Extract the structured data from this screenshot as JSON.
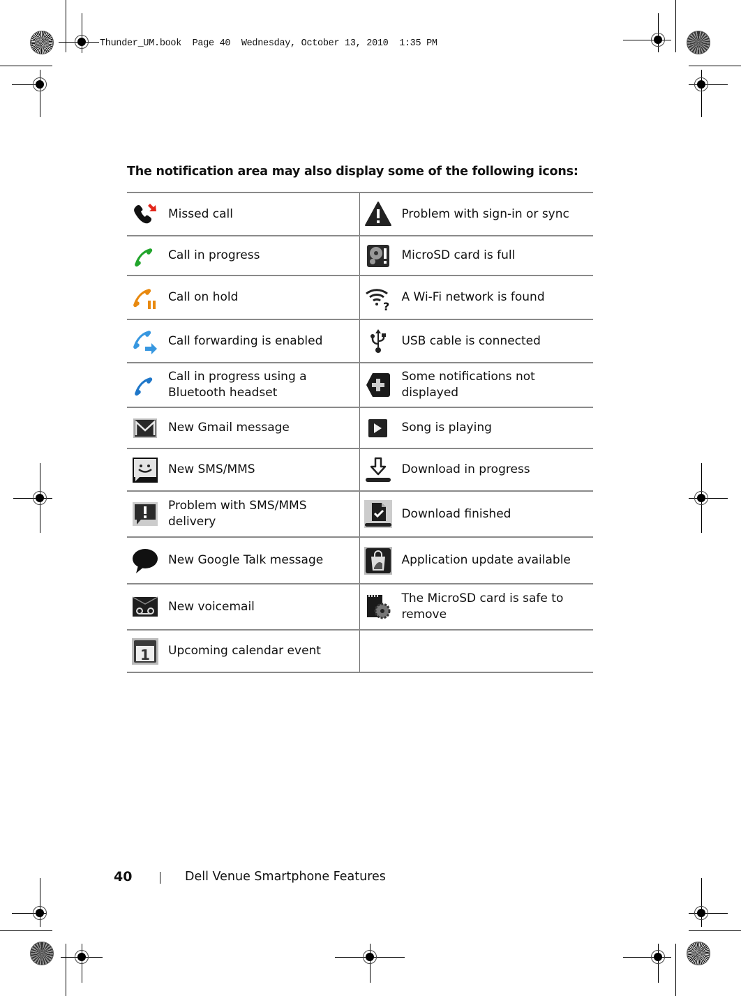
{
  "print_slug": "Thunder_UM.book  Page 40  Wednesday, October 13, 2010  1:35 PM",
  "heading": "The notification area may also display some of the following icons:",
  "table": {
    "rows": [
      {
        "left": {
          "icon": "missed-call-icon",
          "label": "Missed call"
        },
        "right": {
          "icon": "warning-icon",
          "label": "Problem with sign-in or sync"
        }
      },
      {
        "left": {
          "icon": "call-in-progress-icon",
          "label": "Call in progress"
        },
        "right": {
          "icon": "microsd-full-icon",
          "label": "MicroSD card is full"
        }
      },
      {
        "left": {
          "icon": "call-on-hold-icon",
          "label": "Call on hold"
        },
        "right": {
          "icon": "wifi-found-icon",
          "label": "A Wi-Fi network is found"
        }
      },
      {
        "left": {
          "icon": "call-forwarding-icon",
          "label": "Call forwarding is enabled"
        },
        "right": {
          "icon": "usb-icon",
          "label": "USB cable is connected"
        }
      },
      {
        "left": {
          "icon": "bluetooth-call-icon",
          "label": "Call in progress using a Bluetooth headset"
        },
        "right": {
          "icon": "more-notifications-icon",
          "label": "Some notifications not displayed"
        }
      },
      {
        "left": {
          "icon": "gmail-icon",
          "label": "New Gmail message"
        },
        "right": {
          "icon": "play-icon",
          "label": "Song is playing"
        }
      },
      {
        "left": {
          "icon": "sms-icon",
          "label": "New SMS/MMS"
        },
        "right": {
          "icon": "download-icon",
          "label": "Download in progress"
        }
      },
      {
        "left": {
          "icon": "sms-error-icon",
          "label": "Problem with SMS/MMS delivery"
        },
        "right": {
          "icon": "download-finished-icon",
          "label": "Download finished"
        }
      },
      {
        "left": {
          "icon": "gtalk-icon",
          "label": "New Google Talk message"
        },
        "right": {
          "icon": "app-update-icon",
          "label": "Application update available"
        }
      },
      {
        "left": {
          "icon": "voicemail-icon",
          "label": "New voicemail"
        },
        "right": {
          "icon": "microsd-safe-remove-icon",
          "label": "The MicroSD card is safe to remove"
        }
      },
      {
        "left": {
          "icon": "calendar-icon",
          "label": "Upcoming calendar event",
          "calendar_day": "1"
        },
        "right": {
          "icon": "",
          "label": ""
        }
      }
    ]
  },
  "colors": {
    "missed_arrow": "#e3261b",
    "call_green": "#22a52c",
    "call_orange": "#e8890f",
    "call_blue": "#3797e0",
    "bluetooth_blue": "#1f77c9",
    "rule_gray": "#8a8a8a"
  },
  "footer": {
    "page_number": "40",
    "section_title": "Dell Venue Smartphone Features"
  }
}
